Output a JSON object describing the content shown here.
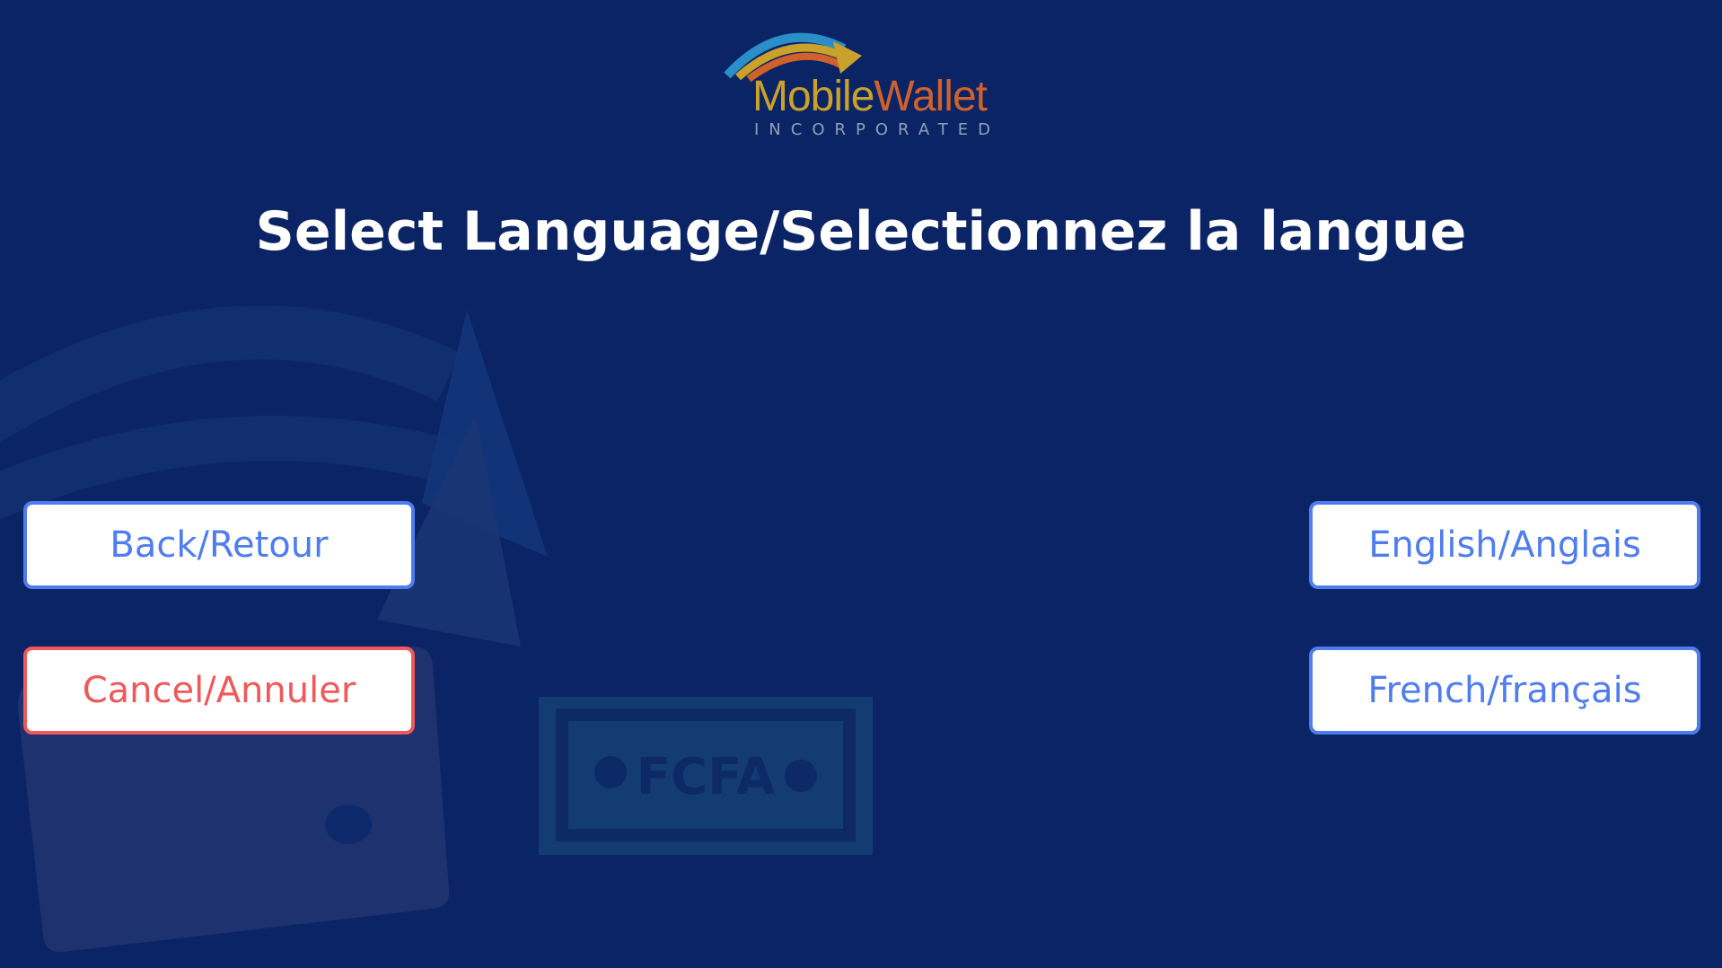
{
  "header": {
    "logo_name": "mobilewallet-logo",
    "logo_text_mobile": "Mobile",
    "logo_text_wallet": "Wallet",
    "logo_subtext": "INCORPORATED"
  },
  "title": "Select Language/Selectionnez la langue",
  "background": {
    "note_label": "FCFA"
  },
  "buttons": {
    "back": "Back/Retour",
    "cancel": "Cancel/Annuler",
    "english": "English/Anglais",
    "french": "French/français"
  },
  "colors": {
    "background": "#0b2466",
    "primary_button": "#4f7df0",
    "cancel_button": "#f0585a",
    "title_text": "#ffffff",
    "logo_mobile": "#c9a12b",
    "logo_wallet": "#d0612a"
  }
}
